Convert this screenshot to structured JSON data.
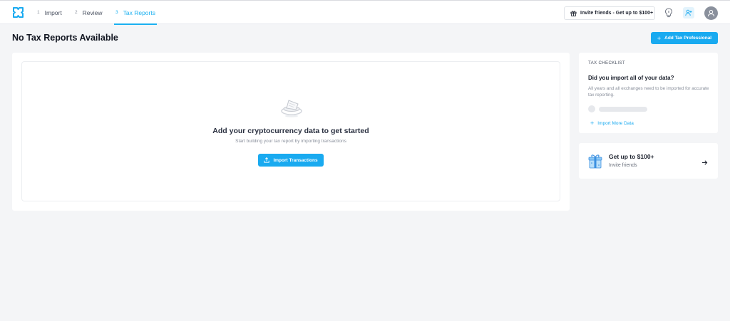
{
  "nav": {
    "steps": [
      {
        "num": "1",
        "label": "Import"
      },
      {
        "num": "2",
        "label": "Review"
      },
      {
        "num": "3",
        "label": "Tax Reports"
      }
    ],
    "active_step": 3,
    "invite_label": "Invite friends - Get up to $100+"
  },
  "page": {
    "title": "No Tax Reports Available",
    "add_pro_label": "Add Tax Professional"
  },
  "empty_state": {
    "title": "Add your cryptocurrency data to get started",
    "subtitle": "Start building your tax report by importing transactions",
    "button_label": "Import Transactions"
  },
  "checklist": {
    "heading": "TAX CHECKLIST",
    "question": "Did you import all of your data?",
    "description": "All years and all exchanges need to be imported for accurate tax reporting.",
    "action_label": "Import More Data"
  },
  "invite_card": {
    "title": "Get up to $100+",
    "subtitle": "Invite friends"
  },
  "icons": {
    "logo": "logo-icon",
    "gift": "gift-icon",
    "hint": "lightbulb-icon",
    "user_plus": "user-plus-icon",
    "avatar": "user-icon",
    "upload": "upload-icon",
    "arrow": "arrow-right-icon"
  },
  "colors": {
    "accent": "#19aaf0",
    "background": "#f4f5f7"
  }
}
